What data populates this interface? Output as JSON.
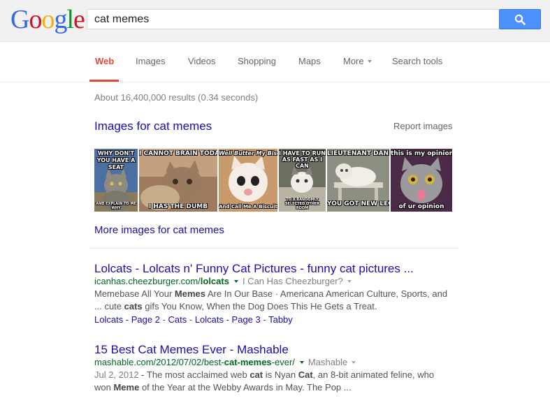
{
  "logo": {
    "letters": [
      "G",
      "o",
      "o",
      "g",
      "l",
      "e"
    ],
    "colors": [
      "#3369e8",
      "#d50f25",
      "#eeb211",
      "#3369e8",
      "#009925",
      "#d50f25"
    ]
  },
  "search": {
    "query": "cat memes",
    "button_icon": "search-icon"
  },
  "tabs": [
    {
      "label": "Web",
      "active": true
    },
    {
      "label": "Images"
    },
    {
      "label": "Videos"
    },
    {
      "label": "Shopping"
    },
    {
      "label": "Maps"
    },
    {
      "label": "More"
    },
    {
      "label": "Search tools"
    }
  ],
  "stats": "About 16,400,000 results (0.34 seconds)",
  "images_block": {
    "title": "Images for cat memes",
    "report": "Report images",
    "more": "More images for cat memes",
    "thumbs": [
      {
        "top": "WHY DON'T YOU HAVE A SEAT",
        "bottom": "AND EXPLAIN TO ME WHY"
      },
      {
        "top": "I CANNOT BRAIN TODAY",
        "bottom": "I HAS THE DUMB"
      },
      {
        "top": "Well Butter My Biscuit",
        "bottom": "And Call Me A Biscuit"
      },
      {
        "top": "I HAVE TO RUN AS FAST AS I CAN",
        "bottom": "TO A RANDOMLY SELECTED OTHER ROOM"
      },
      {
        "top": "LIEUTENANT DAN!",
        "bottom": "YOU GOT NEW LEGS!"
      },
      {
        "top": "this is my opinion",
        "bottom": "of ur opinion"
      }
    ]
  },
  "results": [
    {
      "title": "Lolcats - Lolcats n' Funny Cat Pictures - funny cat pictures ...",
      "url_pre": "icanhas.cheezburger.com/",
      "url_bold": "lolcats",
      "url_post": "",
      "sub": "I Can Has Cheezburger?",
      "snippet_line1_a": "Memebase All Your ",
      "snippet_line1_b": "Memes",
      "snippet_line1_c": " Are In Our Base · Americana American Culture, Sports, and",
      "snippet_line2_a": "... cute ",
      "snippet_line2_b": "cats",
      "snippet_line2_c": " gifs You Know, When the Dog Does This He Gets a Treat.",
      "links": [
        "Lolcats - Page 2",
        "Cats",
        "Lolcats - Page 3",
        "Tabby"
      ]
    },
    {
      "title": "15 Best Cat Memes Ever - Mashable",
      "url_pre": "mashable.com/2012/07/02/best-",
      "url_bold": "cat-memes",
      "url_post": "-ever/",
      "sub": "Mashable",
      "date": "Jul 2, 2012",
      "snippet_line1_a": " - The most acclaimed web ",
      "snippet_line1_b": "cat",
      "snippet_line1_c": " is Nyan ",
      "snippet_line1_d": "Cat",
      "snippet_line1_e": ", an 8-bit animated feline, who",
      "snippet_line2_a": "won ",
      "snippet_line2_b": "Meme",
      "snippet_line2_c": " of the Year at the Webby Awards in May. The Pop ..."
    }
  ]
}
